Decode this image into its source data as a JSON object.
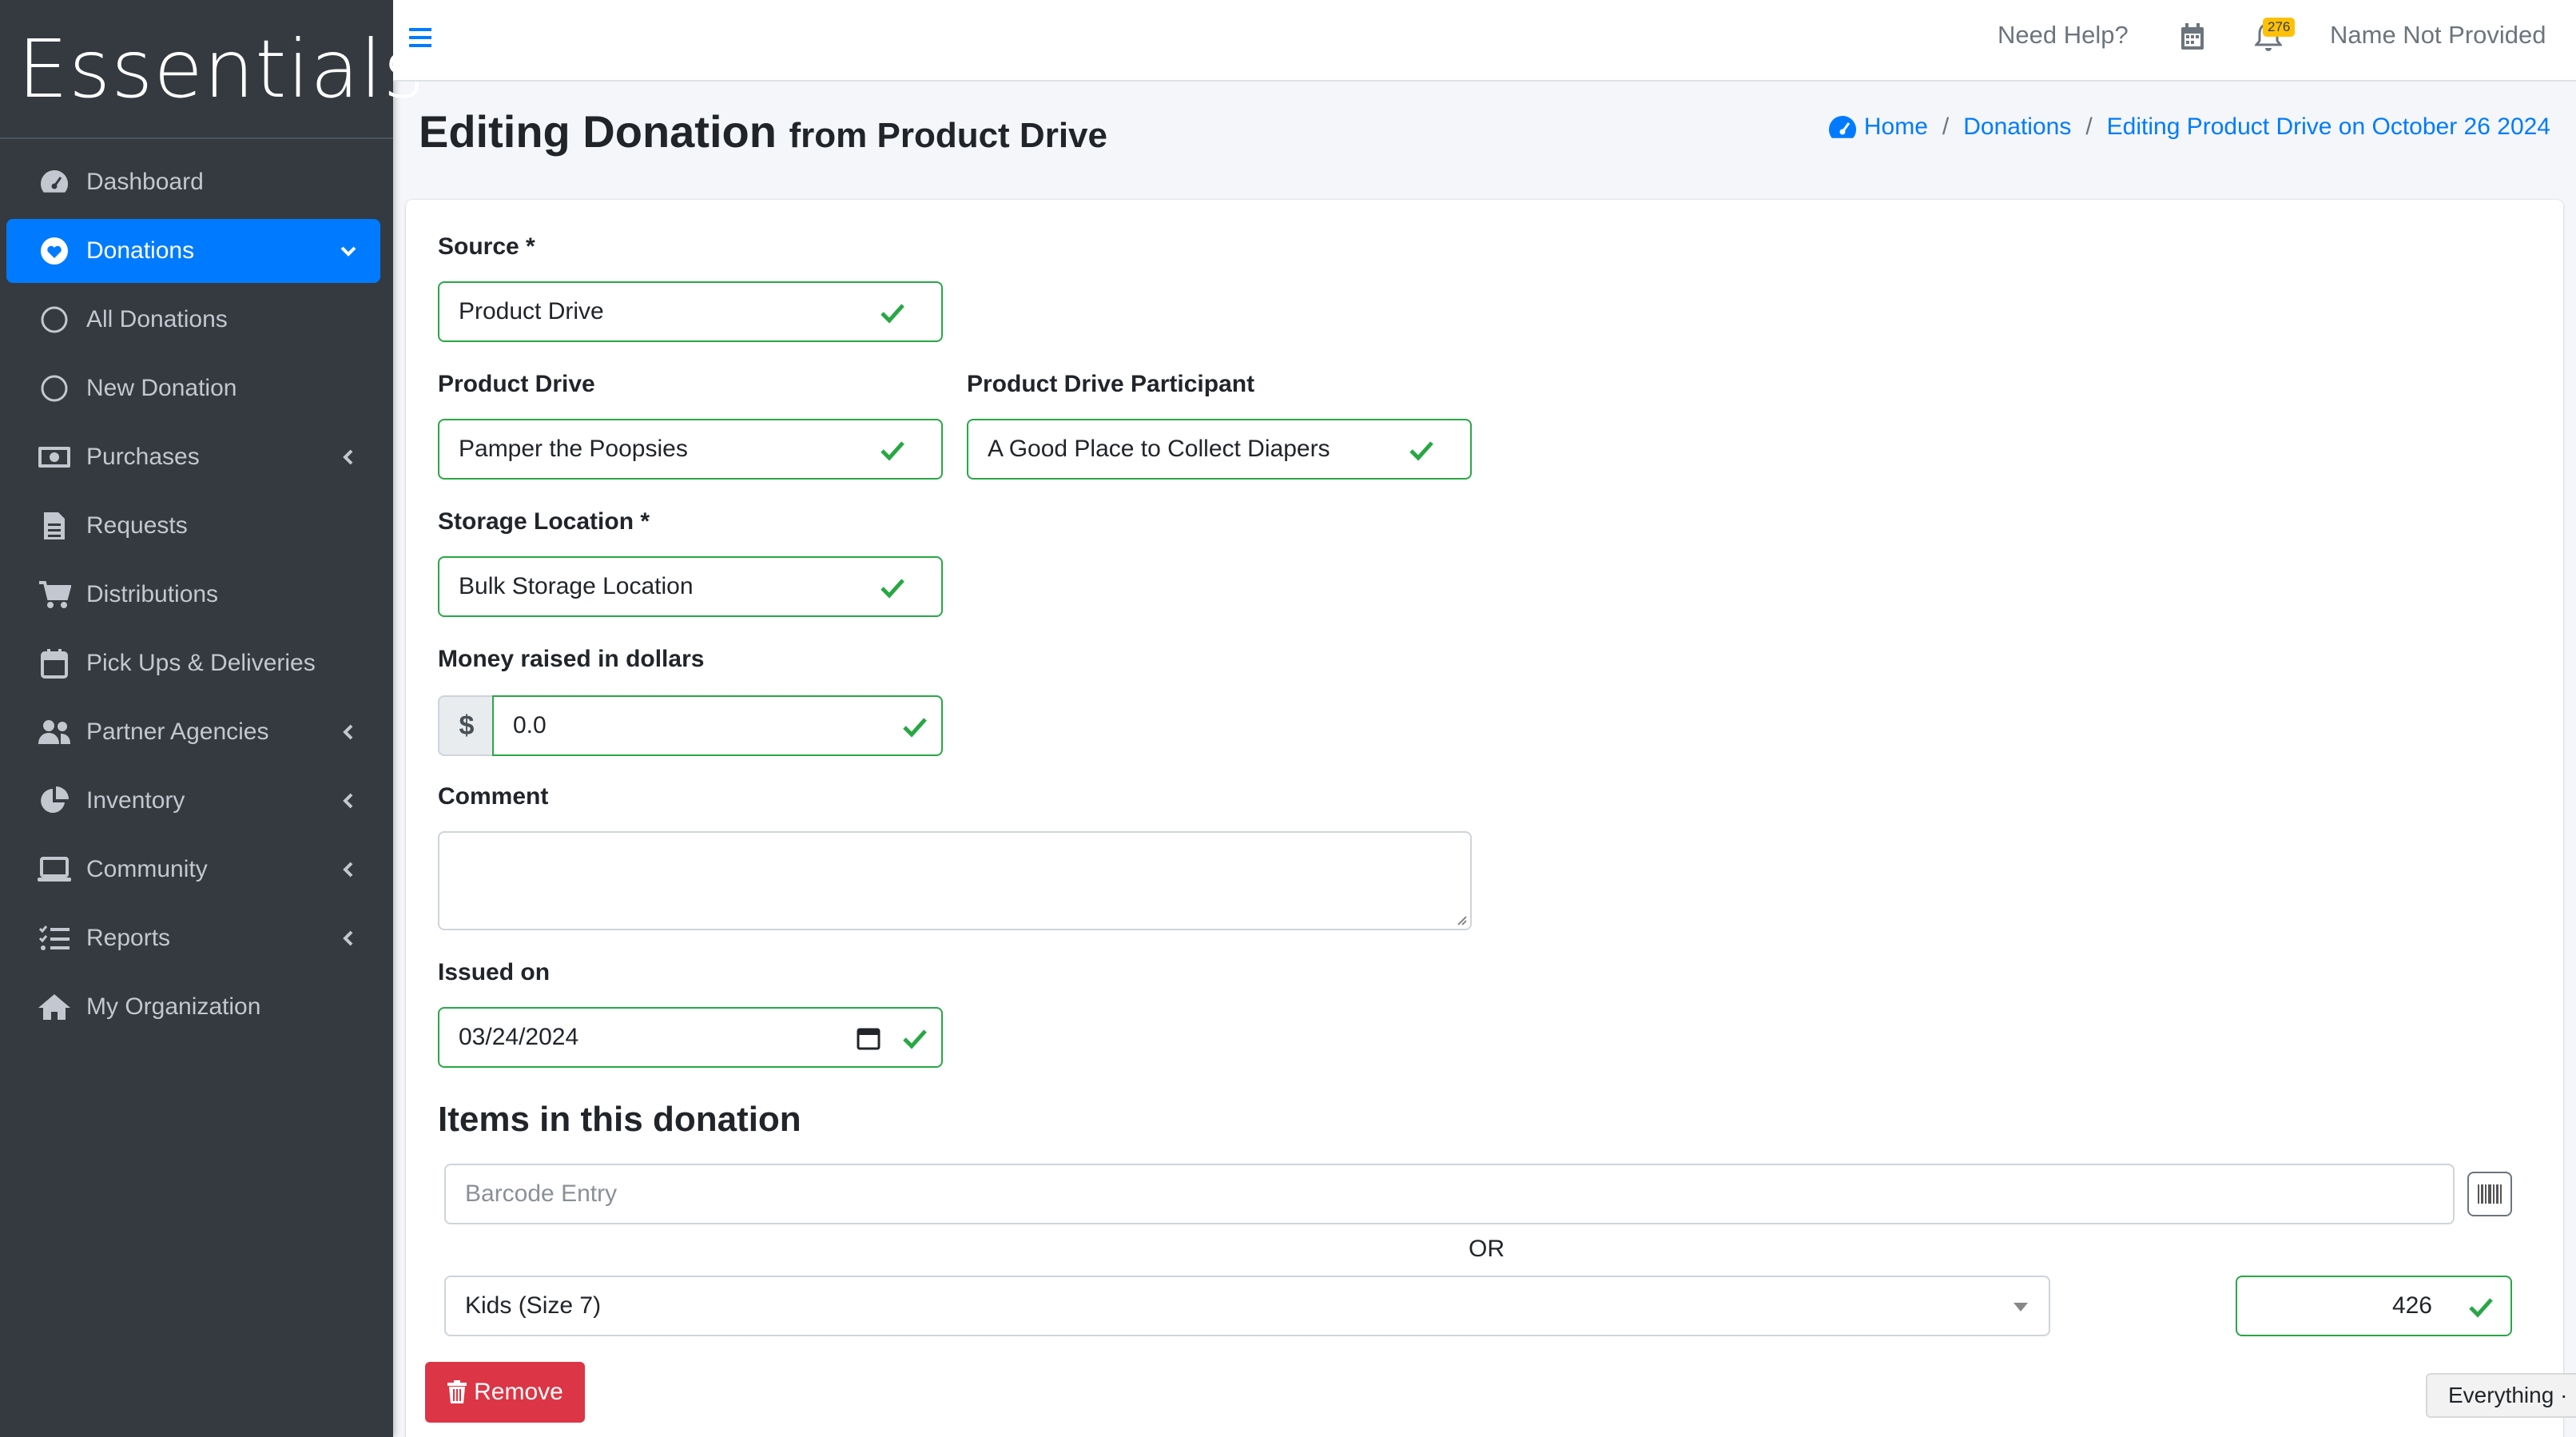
{
  "brand": "Essentials",
  "sidebar": {
    "items": [
      {
        "label": "Dashboard"
      },
      {
        "label": "Donations"
      },
      {
        "label": "All Donations"
      },
      {
        "label": "New Donation"
      },
      {
        "label": "Purchases"
      },
      {
        "label": "Requests"
      },
      {
        "label": "Distributions"
      },
      {
        "label": "Pick Ups & Deliveries"
      },
      {
        "label": "Partner Agencies"
      },
      {
        "label": "Inventory"
      },
      {
        "label": "Community"
      },
      {
        "label": "Reports"
      },
      {
        "label": "My Organization"
      }
    ]
  },
  "topbar": {
    "help": "Need Help?",
    "notification_count": "276",
    "user": "Name Not Provided"
  },
  "header": {
    "title": "Editing Donation",
    "subtitle": "from Product Drive",
    "breadcrumbs": [
      "Home",
      "Donations",
      "Editing Product Drive on October 26 2024"
    ]
  },
  "form": {
    "source": {
      "label": "Source *",
      "value": "Product Drive"
    },
    "product_drive": {
      "label": "Product Drive",
      "value": "Pamper the Poopsies"
    },
    "participant": {
      "label": "Product Drive Participant",
      "value": "A Good Place to Collect Diapers"
    },
    "storage": {
      "label": "Storage Location *",
      "value": "Bulk Storage Location"
    },
    "money": {
      "label": "Money raised in dollars",
      "prefix": "$",
      "value": "0.0"
    },
    "comment": {
      "label": "Comment",
      "value": ""
    },
    "issued_on": {
      "label": "Issued on",
      "value": "03/24/2024"
    }
  },
  "items": {
    "title": "Items in this donation",
    "barcode_placeholder": "Barcode Entry",
    "or": "OR",
    "item": "Kids (Size 7)",
    "quantity": "426",
    "remove": "Remove"
  },
  "footer_pill": "Everything ·",
  "colors": {
    "sidebar": "#343a40",
    "active": "#007bff",
    "valid": "#28a745",
    "danger": "#dc3545"
  }
}
